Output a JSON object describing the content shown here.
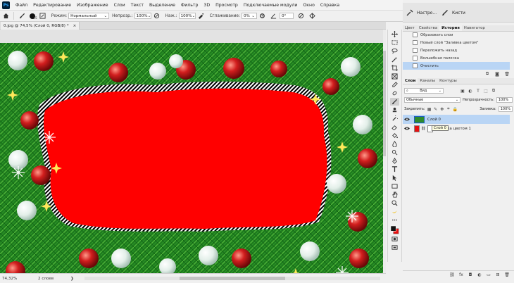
{
  "app": {
    "logo": "Ps"
  },
  "menu": [
    "Файл",
    "Редактирование",
    "Изображение",
    "Слои",
    "Текст",
    "Выделение",
    "Фильтр",
    "3D",
    "Просмотр",
    "Подключаемые модули",
    "Окно",
    "Справка"
  ],
  "window_controls": [
    "—",
    "❐",
    "✕"
  ],
  "options": {
    "brush_size": "15",
    "mode_label": "Режим:",
    "mode_value": "Нормальный",
    "opacity_label": "Непрозр.:",
    "opacity_value": "100%",
    "flow_label": "Наж.:",
    "flow_value": "100%",
    "smoothing_label": "Сглаживание:",
    "smoothing_value": "0%",
    "angle_value": "0°"
  },
  "document_tab": {
    "title": "0.jpg @ 74,5% (Слой 0, RGB/8) *",
    "close": "×"
  },
  "status": {
    "zoom": "74,32%",
    "info": "2 слоев",
    "arrow": "❯"
  },
  "mini_panels": {
    "item1": "Настро...",
    "item2": "Кисти"
  },
  "panel_tabs_top": [
    {
      "label": "Цвет",
      "active": false
    },
    {
      "label": "Свойства",
      "active": false
    },
    {
      "label": "История",
      "active": true
    },
    {
      "label": "Навигатор",
      "active": false
    }
  ],
  "history": [
    {
      "label": "Образовать слои",
      "active": false
    },
    {
      "label": "Новый слой \"Заливка цветом\"",
      "active": false
    },
    {
      "label": "Переложить назад",
      "active": false
    },
    {
      "label": "Волшебная палочка",
      "active": false
    },
    {
      "label": "Очистить",
      "active": true
    }
  ],
  "panel_tabs_layers": [
    {
      "label": "Слои",
      "active": true
    },
    {
      "label": "Каналы",
      "active": false
    },
    {
      "label": "Контуры",
      "active": false
    }
  ],
  "layers_panel": {
    "kind_value": "Вид",
    "blend_value": "Обычные",
    "opacity_label": "Непрозрачность:",
    "opacity_value": "100%",
    "lock_label": "Закрепить:",
    "fill_label": "Заливка:",
    "fill_value": "100%"
  },
  "layers": [
    {
      "name": "Слой 0",
      "selected": true
    },
    {
      "name": "Заливка цветом 1",
      "selected": false
    }
  ],
  "tooltip": "Слой 0",
  "colors": {
    "canvas_red": "#ff0000",
    "selection_blue": "#b9d5f5",
    "foreground": "#111111",
    "background": "#e61010"
  }
}
